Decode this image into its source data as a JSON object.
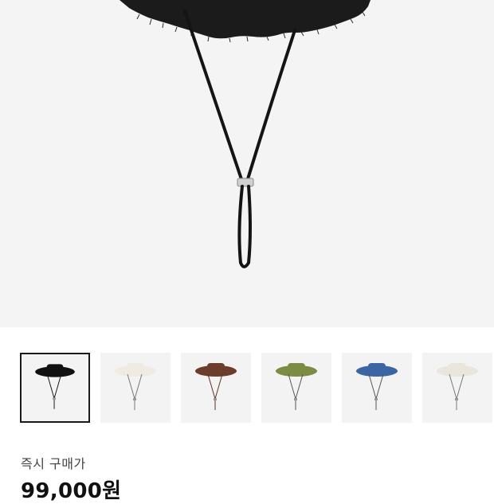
{
  "product": {
    "selected_color": "#111111",
    "thumbnails": [
      {
        "color": "#111111",
        "selected": true
      },
      {
        "color": "#efebe3",
        "selected": false
      },
      {
        "color": "#6b3d2a",
        "selected": false
      },
      {
        "color": "#7d8c45",
        "selected": false
      },
      {
        "color": "#3c65a4",
        "selected": false
      },
      {
        "color": "#e9e6de",
        "selected": false
      }
    ]
  },
  "purchase": {
    "label": "즉시 구매가",
    "price": "99,000원"
  }
}
